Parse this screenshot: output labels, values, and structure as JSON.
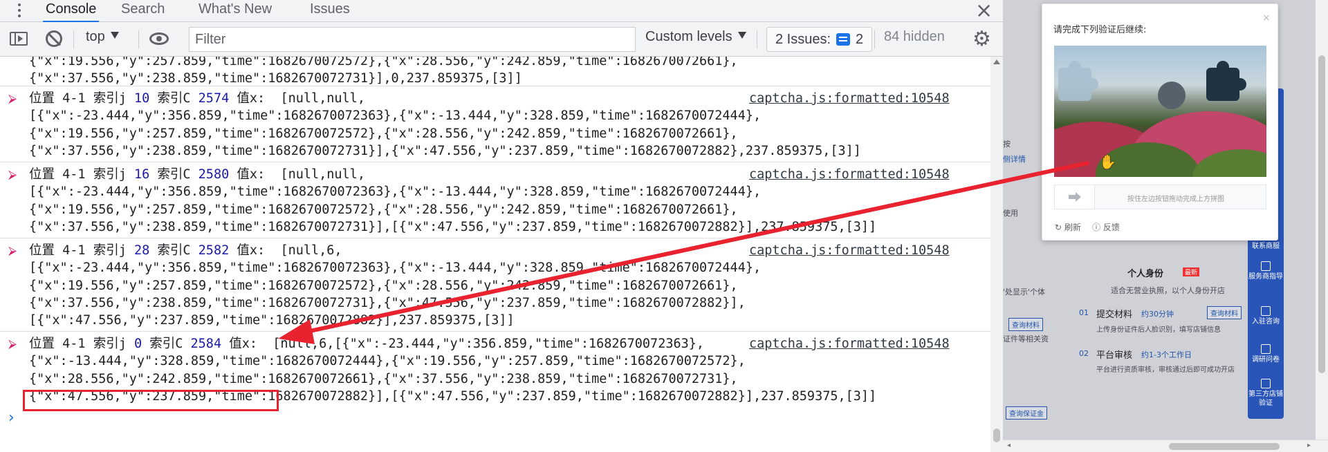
{
  "devtools": {
    "tabs": [
      {
        "label": "Console",
        "active": true
      },
      {
        "label": "Search",
        "active": false
      },
      {
        "label": "What's New",
        "active": false
      },
      {
        "label": "Issues",
        "active": false
      }
    ],
    "toolbar": {
      "context": "top",
      "filter_placeholder": "Filter",
      "levels": "Custom levels",
      "issues_label": "2 Issues:",
      "issues_count": "2",
      "hidden": "84 hidden"
    },
    "console": {
      "previous_tail": [
        "{\"x\":19.556,\"y\":257.859,\"time\":1682670072572},{\"x\":28.556,\"y\":242.859,\"time\":1682670072661},",
        "{\"x\":37.556,\"y\":238.859,\"time\":1682670072731}],0,237.859375,[3]]"
      ],
      "entries": [
        {
          "label": "位置 4-1 索引j ",
          "j": "10",
          "c_label": " 索引C ",
          "c": "2574",
          "value_label": " 值x:  ",
          "first_tail": "[null,null,",
          "lines": [
            "[{\"x\":-23.444,\"y\":356.859,\"time\":1682670072363},{\"x\":-13.444,\"y\":328.859,\"time\":1682670072444},",
            "{\"x\":19.556,\"y\":257.859,\"time\":1682670072572},{\"x\":28.556,\"y\":242.859,\"time\":1682670072661},",
            "{\"x\":37.556,\"y\":238.859,\"time\":1682670072731}],{\"x\":47.556,\"y\":237.859,\"time\":1682670072882},237.859375,[3]]"
          ],
          "source": "captcha.js:formatted:10548"
        },
        {
          "label": "位置 4-1 索引j ",
          "j": "16",
          "c_label": " 索引C ",
          "c": "2580",
          "value_label": " 值x:  ",
          "first_tail": "[null,null,",
          "lines": [
            "[{\"x\":-23.444,\"y\":356.859,\"time\":1682670072363},{\"x\":-13.444,\"y\":328.859,\"time\":1682670072444},",
            "{\"x\":19.556,\"y\":257.859,\"time\":1682670072572},{\"x\":28.556,\"y\":242.859,\"time\":1682670072661},",
            "{\"x\":37.556,\"y\":238.859,\"time\":1682670072731}],[{\"x\":47.556,\"y\":237.859,\"time\":1682670072882}],237.859375,[3]]"
          ],
          "source": "captcha.js:formatted:10548"
        },
        {
          "label": "位置 4-1 索引j ",
          "j": "28",
          "c_label": " 索引C ",
          "c": "2582",
          "value_label": " 值x:  ",
          "first_tail": "[null,6,",
          "lines": [
            "[{\"x\":-23.444,\"y\":356.859,\"time\":1682670072363},{\"x\":-13.444,\"y\":328.859,\"time\":1682670072444},",
            "{\"x\":19.556,\"y\":257.859,\"time\":1682670072572},{\"x\":28.556,\"y\":242.859,\"time\":1682670072661},",
            "{\"x\":37.556,\"y\":238.859,\"time\":1682670072731},{\"x\":47.556,\"y\":237.859,\"time\":1682670072882}],",
            "[{\"x\":47.556,\"y\":237.859,\"time\":1682670072882}],237.859375,[3]]"
          ],
          "source": "captcha.js:formatted:10548"
        },
        {
          "label": "位置 4-1 索引j ",
          "j": "0",
          "c_label": " 索引C ",
          "c": "2584",
          "value_label": " 值x:  ",
          "first_tail": "[null,6,[{\"x\":-23.444,\"y\":356.859,\"time\":1682670072363},",
          "lines": [
            "{\"x\":-13.444,\"y\":328.859,\"time\":1682670072444},{\"x\":19.556,\"y\":257.859,\"time\":1682670072572},",
            "{\"x\":28.556,\"y\":242.859,\"time\":1682670072661},{\"x\":37.556,\"y\":238.859,\"time\":1682670072731},",
            "{\"x\":47.556,\"y\":237.859,\"time\":1682670072882}],[{\"x\":47.556,\"y\":237.859,\"time\":1682670072882}],237.859375,[3]]"
          ],
          "source": "captcha.js:formatted:10548"
        }
      ],
      "prompt": "›"
    }
  },
  "captcha": {
    "title": "请完成下列验证后继续:",
    "close": "×",
    "slider_hint": "按住左边按钮拖动完成上方拼图",
    "refresh": "刷新",
    "feedback": "反馈"
  },
  "background_page": {
    "frag_1": "按",
    "frag_2": "侧详情",
    "frag_3": "使用",
    "frag_4": "'处显示'个体",
    "frag_5": "证件等相关资",
    "personal_identity": "个人身份",
    "badge_new": "最新",
    "applicable": "适合无营业执照，以个人身份开店",
    "step1_no": "01",
    "step1_title": "提交材料",
    "step1_time": "约30分钟",
    "step1_desc": "上传身份证件后人脸识别，填写店铺信息",
    "step1_btn": "查询材料",
    "step2_no": "02",
    "step2_title": "平台审核",
    "step2_time": "约1-3个工作日",
    "step2_desc": "平台进行资质审核，审核通过后即可成功开店",
    "query_material": "查询材料",
    "query_deposit": "查询保证金",
    "rail": [
      "联系商服",
      "服务商指导",
      "入驻咨询",
      "调研问卷",
      "第三方店铺验证"
    ]
  }
}
